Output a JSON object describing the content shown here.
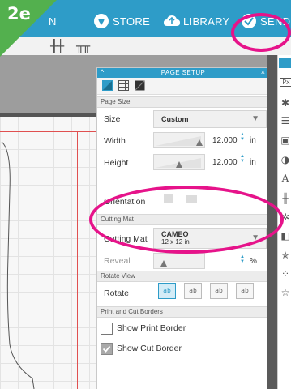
{
  "badge": "2e",
  "nav": {
    "partial_left": "N",
    "store": "STORE",
    "library": "LIBRARY",
    "send": "SEND"
  },
  "panel": {
    "title": "PAGE SETUP",
    "sections": {
      "page_size": "Page Size",
      "cutting_mat": "Cutting Mat",
      "rotate_view": "Rotate View",
      "borders": "Print and Cut Borders"
    },
    "size": {
      "label": "Size",
      "value": "Custom"
    },
    "width": {
      "label": "Width",
      "value": "12.000",
      "unit": "in"
    },
    "height": {
      "label": "Height",
      "value": "12.000",
      "unit": "in"
    },
    "orientation": {
      "label": "Orientation"
    },
    "cutting_mat": {
      "label": "Cutting Mat",
      "value_line1": "CAMEO",
      "value_line2": "12 x 12 in"
    },
    "reveal": {
      "label": "Reveal",
      "value": "",
      "unit": "%"
    },
    "rotate": {
      "label": "Rotate",
      "buttons": [
        "ab",
        "ab",
        "ab",
        "ab"
      ]
    },
    "show_print_border": {
      "label": "Show Print Border",
      "checked": false
    },
    "show_cut_border": {
      "label": "Show Cut Border",
      "checked": true
    }
  },
  "colors": {
    "brand_blue": "#2e9cc8",
    "annotation_pink": "#e6138a",
    "badge_green": "#53b04e"
  }
}
